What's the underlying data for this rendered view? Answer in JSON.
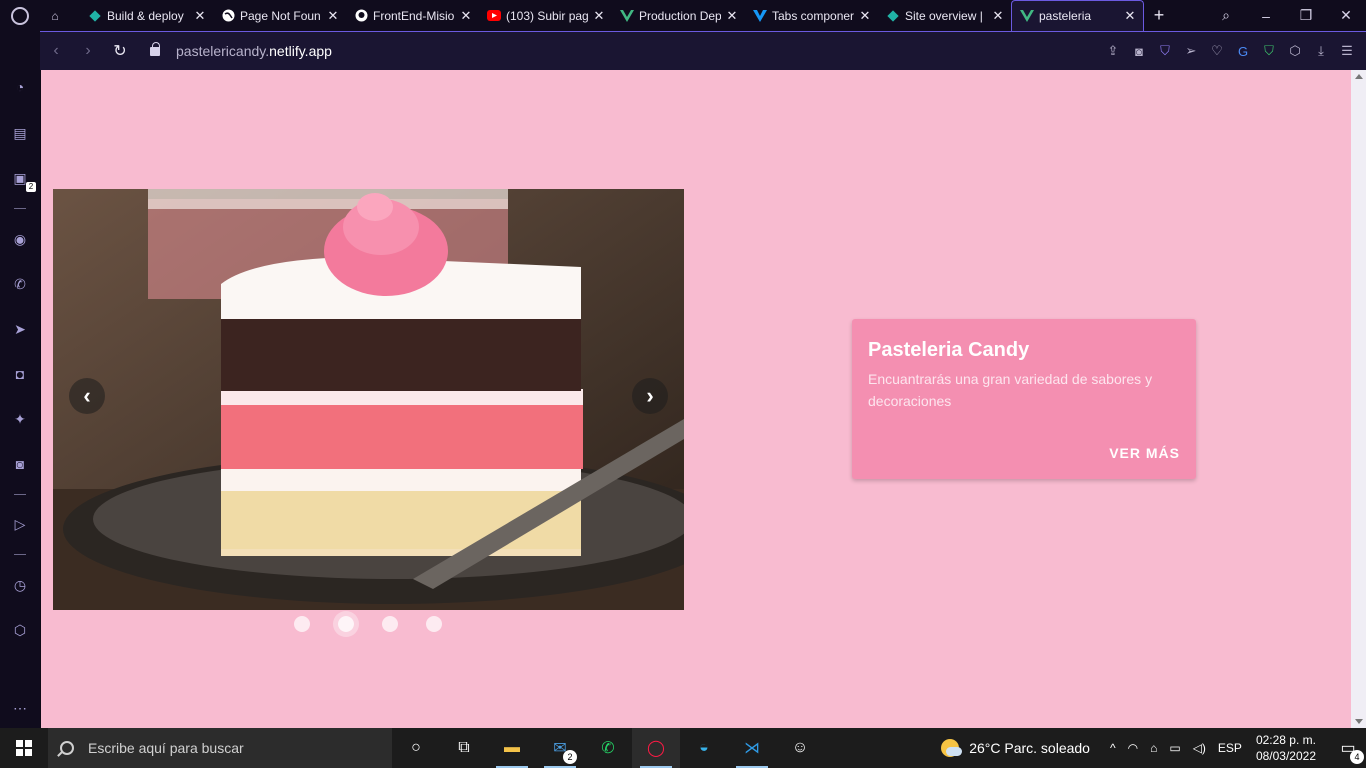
{
  "tabs": [
    {
      "title": "",
      "icon": "gamepad-icon"
    },
    {
      "title": "Build & deploy",
      "icon": "netlify-icon",
      "color": "#20b2a6"
    },
    {
      "title": "Page Not Foun",
      "icon": "globe-icon",
      "color": "#ffffff"
    },
    {
      "title": "FrontEnd-Misio",
      "icon": "github-icon",
      "color": "#ffffff"
    },
    {
      "title": "(103) Subir pag",
      "icon": "youtube-icon",
      "color": "#ff0000"
    },
    {
      "title": "Production Dep",
      "icon": "vue-icon",
      "color": "#41b883"
    },
    {
      "title": "Tabs componer",
      "icon": "vuetify-icon",
      "color": "#1697f6"
    },
    {
      "title": "Site overview |",
      "icon": "netlify-icon",
      "color": "#20b2a6"
    },
    {
      "title": "pasteleria",
      "icon": "vue-icon",
      "color": "#41b883",
      "active": true
    }
  ],
  "address": {
    "url_prefix": "pastelericandy.",
    "url_domain": "netlify.app"
  },
  "sidebar": {
    "twitch_badge": "2"
  },
  "page": {
    "background": "#f8bbd0",
    "card": {
      "title": "Pasteleria Candy",
      "text": "Encuantrarás una gran variedad de sabores y decoraciones",
      "action": "VER MÁS",
      "color": "#f48fb1"
    },
    "carousel": {
      "slides": 4,
      "active_index": 1,
      "prev_glyph": "‹",
      "next_glyph": "›"
    }
  },
  "taskbar": {
    "search_placeholder": "Escribe aquí para buscar",
    "mail_badge": "2",
    "weather": "26°C  Parc. soleado",
    "lang": "ESP",
    "time": "02:28 p. m.",
    "date": "08/03/2022",
    "notifications": "4"
  }
}
